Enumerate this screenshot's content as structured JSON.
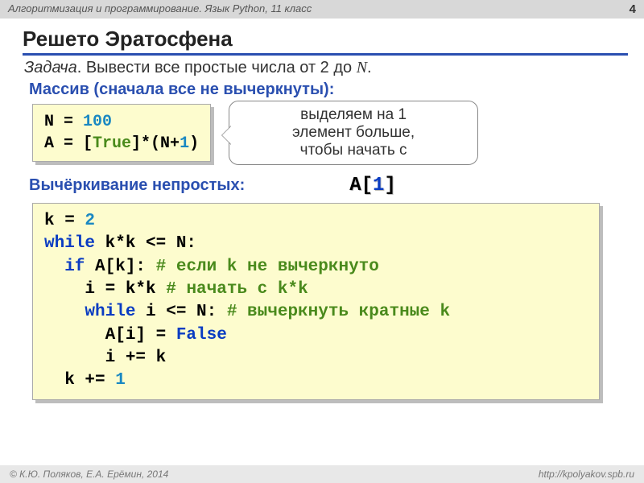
{
  "header": {
    "course": "Алгоритмизация и программирование. Язык Python, 11 класс",
    "page": "4"
  },
  "title": "Решето Эратосфена",
  "task": {
    "label": "Задача",
    "text": ". Вывести все простые числа от 2 до ",
    "var": "N",
    "end": "."
  },
  "section1": "Массив (сначала все не вычеркнуты):",
  "code1": {
    "l1a": "N",
    "l1b": " = ",
    "l1c": "100",
    "l2a": "A",
    "l2b": " = [",
    "l2c": "True",
    "l2d": "]*(N+",
    "l2e": "1",
    "l2f": ")"
  },
  "callout": {
    "l1": "выделяем на 1",
    "l2": "элемент больше,",
    "l3": "чтобы начать с"
  },
  "section2": "Вычёркивание непростых:",
  "arr": {
    "pre": "A[",
    "idx": "1",
    "post": "]"
  },
  "code2": {
    "l1a": "k = ",
    "l1b": "2",
    "l2a": "while",
    "l2b": " k*k <= N:",
    "l3a": "  if",
    "l3b": " A[k]: ",
    "l3c": "# если k не вычеркнуто",
    "l4a": "    i",
    "l4b": " = ",
    "l4c": "k*k ",
    "l4d": "# начать с k*k",
    "l5a": "    while",
    "l5b": " i <= N: ",
    "l5c": "# вычеркнуть кратные k",
    "l6a": "      A[i] = ",
    "l6b": "False",
    "l7a": "      i += k",
    "l8a": "  k += ",
    "l8b": "1"
  },
  "footer": {
    "left": "© К.Ю. Поляков, Е.А. Ерёмин, 2014",
    "right": "http://kpolyakov.spb.ru"
  }
}
